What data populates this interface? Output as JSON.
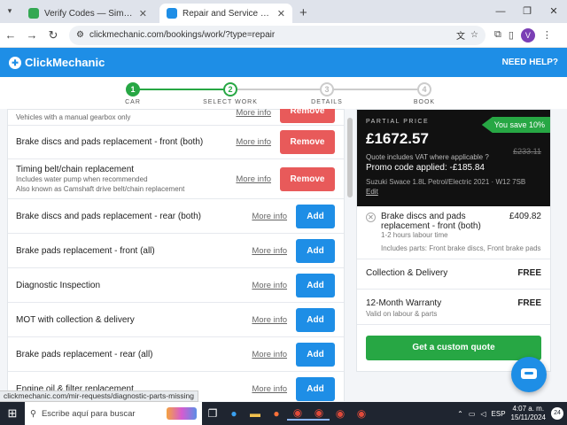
{
  "browser": {
    "tabs": [
      {
        "title": "Verify Codes — SimplyCodes",
        "active": false,
        "favicon_color": "#34a853"
      },
      {
        "title": "Repair and Service Details | Boo",
        "active": true,
        "favicon_color": "#1e8ee6"
      }
    ],
    "url": "clickmechanic.com/bookings/work/?type=repair",
    "profile_initial": "V"
  },
  "site": {
    "brand": "ClickMechanic",
    "need_help": "NEED HELP?",
    "brand_color": "#1e8ee6"
  },
  "stepper": [
    {
      "num": "1",
      "label": "CAR",
      "state": "done"
    },
    {
      "num": "2",
      "label": "SELECT WORK",
      "state": "current"
    },
    {
      "num": "3",
      "label": "DETAILS",
      "state": "todo"
    },
    {
      "num": "4",
      "label": "BOOK",
      "state": "todo"
    }
  ],
  "services": [
    {
      "title": "",
      "sub": "Vehicles with a manual gearbox only",
      "more": "More info",
      "action": "Remove",
      "type": "remove"
    },
    {
      "title": "Brake discs and pads replacement - front (both)",
      "sub": "",
      "more": "More info",
      "action": "Remove",
      "type": "remove"
    },
    {
      "title": "Timing belt/chain replacement",
      "sub": "Includes water pump when recommended\nAlso known as Camshaft drive belt/chain replacement",
      "more": "More info",
      "action": "Remove",
      "type": "remove"
    },
    {
      "title": "Brake discs and pads replacement - rear (both)",
      "sub": "",
      "more": "More info",
      "action": "Add",
      "type": "add"
    },
    {
      "title": "Brake pads replacement - front (all)",
      "sub": "",
      "more": "More info",
      "action": "Add",
      "type": "add"
    },
    {
      "title": "Diagnostic Inspection",
      "sub": "",
      "more": "More info",
      "action": "Add",
      "type": "add"
    },
    {
      "title": "MOT with collection & delivery",
      "sub": "",
      "more": "More info",
      "action": "Add",
      "type": "add"
    },
    {
      "title": "Brake pads replacement - rear (all)",
      "sub": "",
      "more": "More info",
      "action": "Add",
      "type": "add"
    },
    {
      "title": "Engine oil & filter replacement",
      "sub": "",
      "more": "More info",
      "action": "Add",
      "type": "add"
    }
  ],
  "summary": {
    "partial_label": "PARTIAL PRICE",
    "price": "£1672.57",
    "old_price": "£233.11",
    "you_save": "You save 10%",
    "vat": "Quote includes VAT where applicable",
    "promo": "Promo code applied: -£185.84",
    "car": "Suzuki Swace 1.8L Petrol/Electric 2021 · W12 7SB",
    "edit": "Edit",
    "item": {
      "title": "Brake discs and pads replacement - front (both)",
      "price": "£409.82",
      "labour": "1-2 hours labour time",
      "parts": "Includes parts: Front brake discs, Front brake pads"
    },
    "features": [
      {
        "title": "Collection & Delivery",
        "sub": "",
        "value": "FREE"
      },
      {
        "title": "12-Month Warranty",
        "sub": "Valid on labour & parts",
        "value": "FREE"
      }
    ],
    "cta": "Get a custom quote"
  },
  "status_url": "clickmechanic.com/mir-requests/diagnostic-parts-missing",
  "taskbar": {
    "search_placeholder": "Escribe aquí para buscar",
    "lang": "ESP",
    "time": "4:07 a. m.",
    "date": "15/11/2024",
    "notifications": "24"
  }
}
